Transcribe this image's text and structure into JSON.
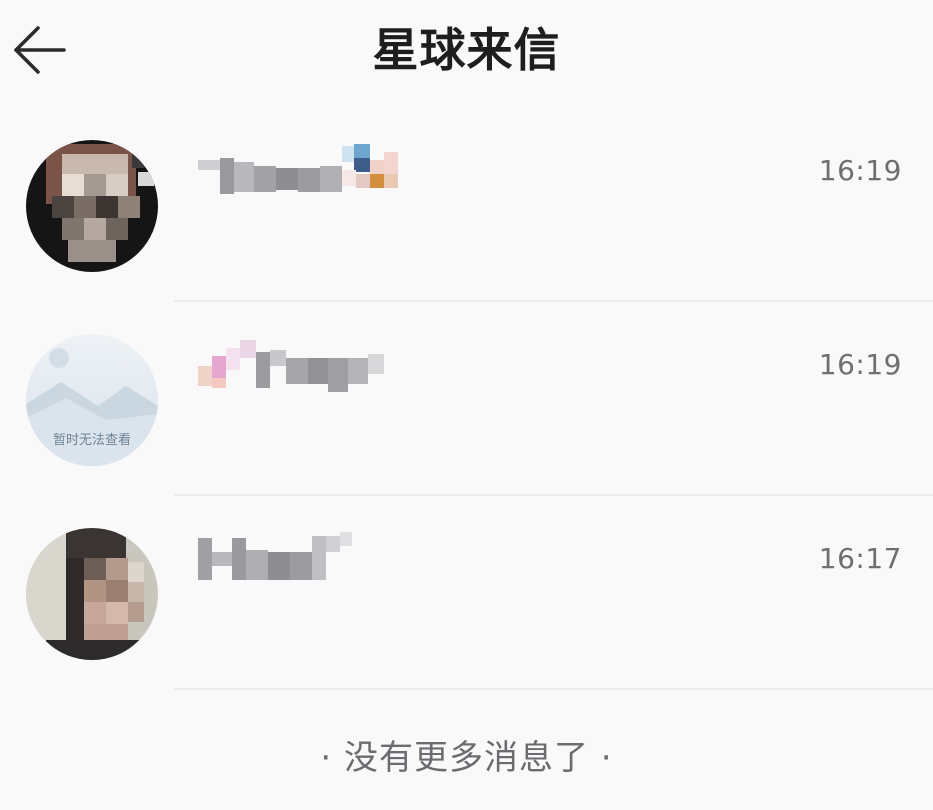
{
  "header": {
    "title": "星球来信",
    "back_icon": "arrow-left-icon"
  },
  "messages": [
    {
      "time": "16:19",
      "avatar": "user-avatar-photo"
    },
    {
      "time": "16:19",
      "avatar": "image-unavailable-placeholder",
      "placeholder_text": "暂时无法查看"
    },
    {
      "time": "16:17",
      "avatar": "user-avatar-photo"
    }
  ],
  "footer": {
    "text": "· 没有更多消息了 ·"
  },
  "colors": {
    "background": "#f9f9fa",
    "title": "#1e1e1e",
    "time": "#6f6f72",
    "divider": "#ececee"
  }
}
